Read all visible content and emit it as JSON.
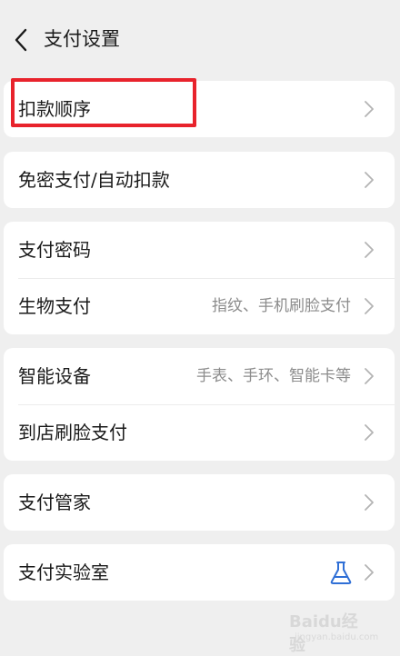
{
  "header": {
    "back_icon": "chevron-left-icon",
    "title": "支付设置"
  },
  "groups": [
    {
      "items": [
        {
          "label": "扣款顺序",
          "value": "",
          "icon": "chevron-right-icon"
        }
      ]
    },
    {
      "items": [
        {
          "label": "免密支付/自动扣款",
          "value": "",
          "icon": "chevron-right-icon"
        }
      ]
    },
    {
      "items": [
        {
          "label": "支付密码",
          "value": "",
          "icon": "chevron-right-icon"
        },
        {
          "label": "生物支付",
          "value": "指纹、手机刷脸支付",
          "icon": "chevron-right-icon"
        }
      ]
    },
    {
      "items": [
        {
          "label": "智能设备",
          "value": "手表、手环、智能卡等",
          "icon": "chevron-right-icon"
        },
        {
          "label": "到店刷脸支付",
          "value": "",
          "icon": "chevron-right-icon"
        }
      ]
    },
    {
      "items": [
        {
          "label": "支付管家",
          "value": "",
          "icon": "chevron-right-icon"
        }
      ]
    },
    {
      "items": [
        {
          "label": "支付实验室",
          "value": "",
          "icon": "flask-icon"
        }
      ]
    }
  ],
  "highlight": {
    "target": "扣款顺序",
    "color": "#e8232c"
  },
  "watermark": {
    "brand": "Baidu经验",
    "url": "jingyan.baidu.com"
  },
  "colors": {
    "background": "#efefef",
    "card": "#ffffff",
    "text_primary": "#1a1a1a",
    "text_secondary": "#8c8c8c",
    "accent_icon": "#2f6fd6"
  }
}
